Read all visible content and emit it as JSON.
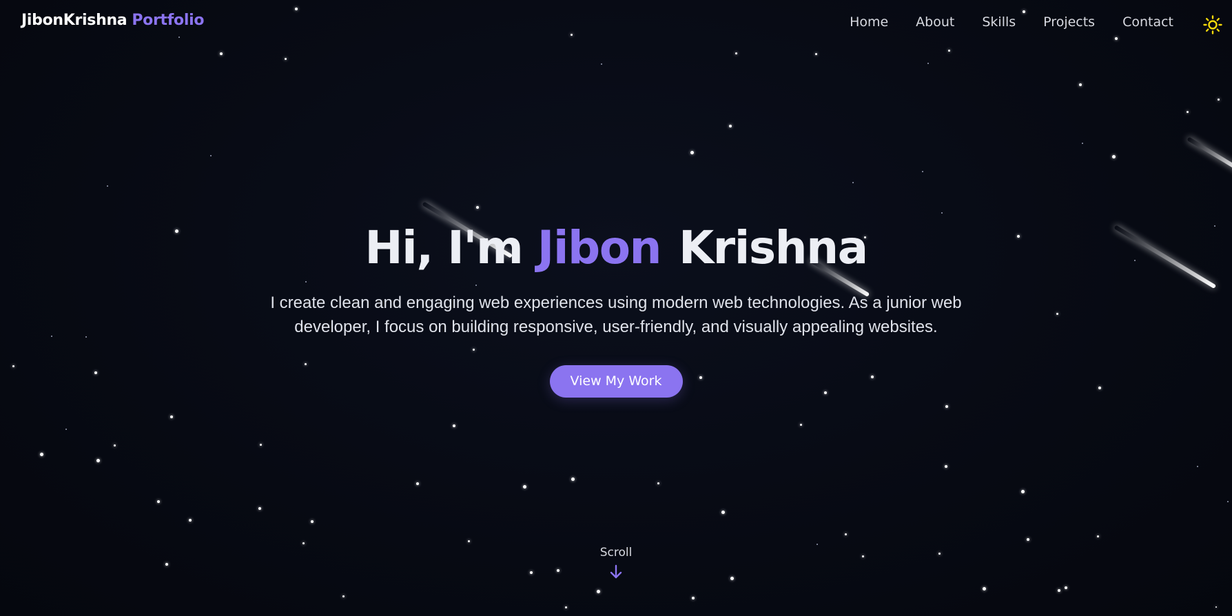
{
  "brand": {
    "name": "JibonKrishna",
    "accent": "Portfolio"
  },
  "nav": {
    "items": [
      {
        "label": "Home"
      },
      {
        "label": "About"
      },
      {
        "label": "Skills"
      },
      {
        "label": "Projects"
      },
      {
        "label": "Contact"
      }
    ],
    "theme_toggle_icon": "sun-icon"
  },
  "hero": {
    "greeting": "Hi, I'm ",
    "first_name": "Jibon",
    "last_name": "Krishna",
    "description": "I create clean and engaging web experiences using modern web technologies. As a junior web developer, I focus on building responsive, user-friendly, and visually appealing websites.",
    "cta_label": "View My Work"
  },
  "scroll": {
    "label": "Scroll",
    "icon": "arrow-down-icon"
  },
  "colors": {
    "background": "#070a13",
    "accent": "#8b74f0",
    "text": "#eceef4",
    "sun": "#f5d90a"
  }
}
